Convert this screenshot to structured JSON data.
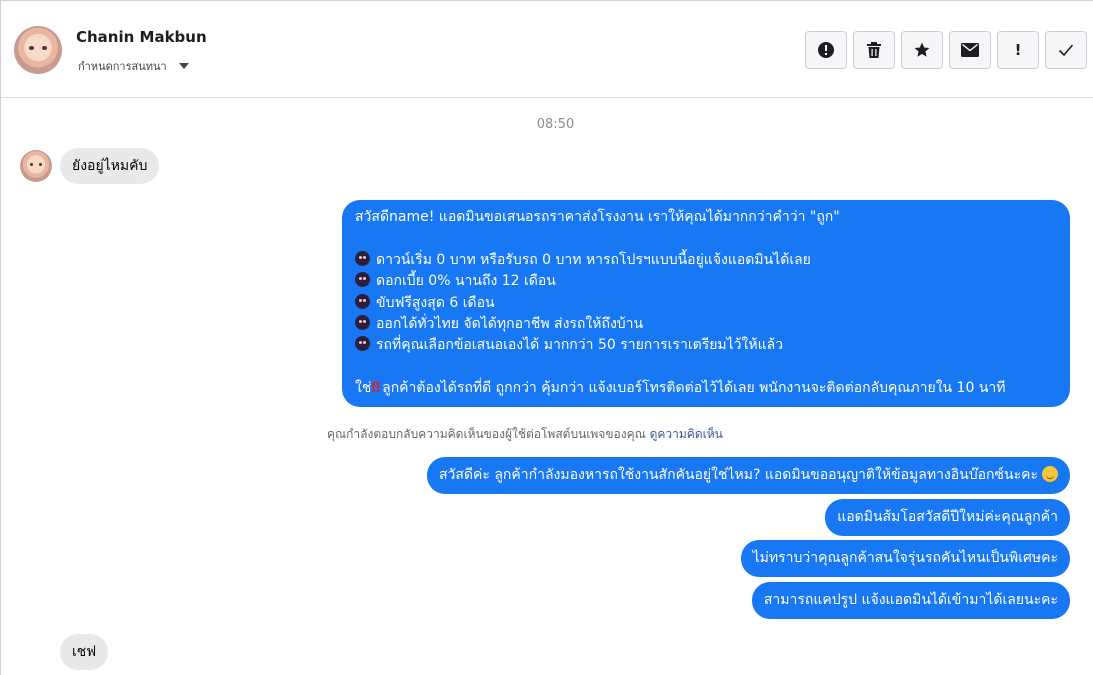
{
  "header": {
    "contact_name": "Chanin Makbun",
    "assign_label": "กำหนดการสนทนา",
    "toolbar": [
      {
        "name": "spam-button",
        "icon": "alert-circle-icon"
      },
      {
        "name": "delete-button",
        "icon": "trash-icon"
      },
      {
        "name": "star-button",
        "icon": "star-icon"
      },
      {
        "name": "mark-unread-button",
        "icon": "envelope-icon"
      },
      {
        "name": "follow-up-button",
        "icon": "exclamation-icon",
        "label": "!"
      },
      {
        "name": "mark-done-button",
        "icon": "checkmark-icon"
      }
    ]
  },
  "conversation": {
    "timestamp": "08:50",
    "incoming_1": "ยังอยู่ไหมคับ",
    "big_message": {
      "line1": "สวัสดีname! แอดมินขอเสนอรถราคาส่งโรงงาน เราให้คุณได้มากกว่าคำว่า \"ถูก\"",
      "bullets": [
        "ดาวน์เริ่ม 0 บาท หรือรับรถ 0 บาท หารถโปรฯแบบนี้อยู่แจ้งแอดมินได้เลย",
        "ดอกเบี้ย 0% นานถึง 12 เดือน",
        "ขับฟรีสูงสุด 6 เดือน",
        "ออกได้ทั่วไทย จัดได้ทุกอาชีพ ส่งรถให้ถึงบ้าน",
        "รถที่คุณเลือกข้อเสนอเองได้ มากกว่า 50 รายการเราเตรียมไว้ให้แล้ว"
      ],
      "closing_prefix": "ใช่",
      "closing_marks": "‼",
      "closing_rest": "ลูกค้าต้องได้รถที่ดี ถูกกว่า คุ้มกว่า แจ้งเบอร์โทรติดต่อไว้ได้เลย พนักงานจะติดต่อกลับคุณภายใน 10 นาที"
    },
    "notice_text": "คุณกำลังตอบกลับความคิดเห็นของผู้ใช้ต่อโพสต์บนเพจของคุณ",
    "notice_link": "ดูความคิดเห็น",
    "outgoing": [
      "สวัสดีค่ะ ลูกค้ากำลังมองหารถใช้งานสักคันอยู่ใช่ไหม? แอดมินขออนุญาติให้ข้อมูลทางอินบ๊อกซ์นะคะ",
      "แอดมินส้มโอสวัสดีปีใหม่ค่ะคุณลูกค้า",
      "ไม่ทราบว่าคุณลูกค้าสนใจรุ่นรถคันไหนเป็นพิเศษคะ",
      "สามารถแคปรูป แจ้งแอดมินได้เข้ามาได้เลยนะคะ"
    ],
    "incoming_2": "เชฟ"
  },
  "colors": {
    "outgoing_bubble": "#1877f2",
    "incoming_bubble": "#e9e9eb",
    "link": "#385898"
  }
}
